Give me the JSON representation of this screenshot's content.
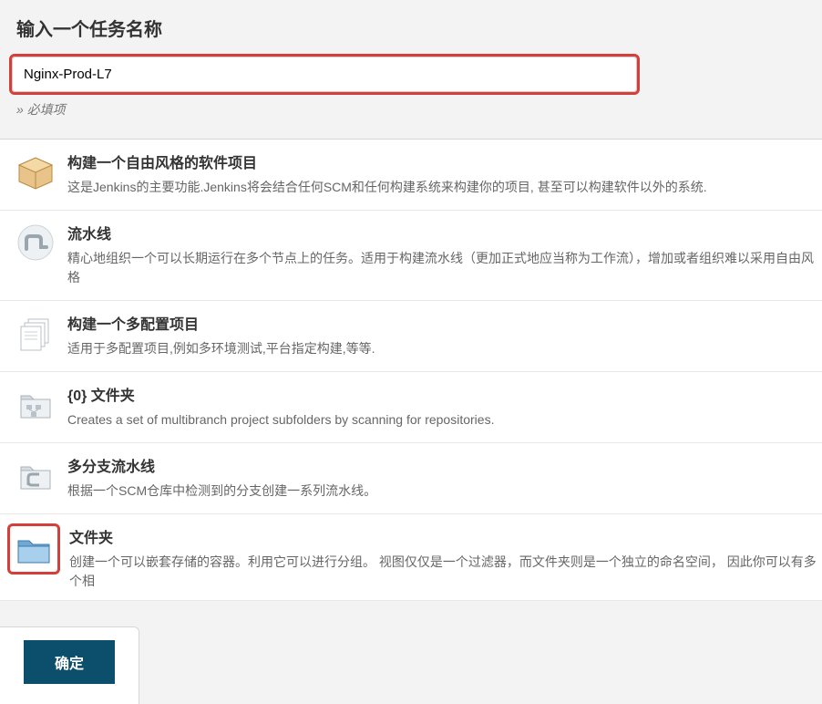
{
  "page": {
    "title": "输入一个任务名称",
    "required_hint": "» 必填项"
  },
  "input": {
    "value": "Nginx-Prod-L7"
  },
  "items": [
    {
      "title": "构建一个自由风格的软件项目",
      "desc": "这是Jenkins的主要功能.Jenkins将会结合任何SCM和任何构建系统来构建你的项目, 甚至可以构建软件以外的系统."
    },
    {
      "title": "流水线",
      "desc": "精心地组织一个可以长期运行在多个节点上的任务。适用于构建流水线（更加正式地应当称为工作流），增加或者组织难以采用自由风格"
    },
    {
      "title": "构建一个多配置项目",
      "desc": "适用于多配置项目,例如多环境测试,平台指定构建,等等."
    },
    {
      "title": "{0} 文件夹",
      "desc": "Creates a set of multibranch project subfolders by scanning for repositories."
    },
    {
      "title": "多分支流水线",
      "desc": "根据一个SCM仓库中检测到的分支创建一系列流水线。"
    },
    {
      "title": "文件夹",
      "desc": "创建一个可以嵌套存储的容器。利用它可以进行分组。 视图仅仅是一个过滤器，而文件夹则是一个独立的命名空间， 因此你可以有多个相"
    }
  ],
  "footer": {
    "ok_label": "确定"
  }
}
